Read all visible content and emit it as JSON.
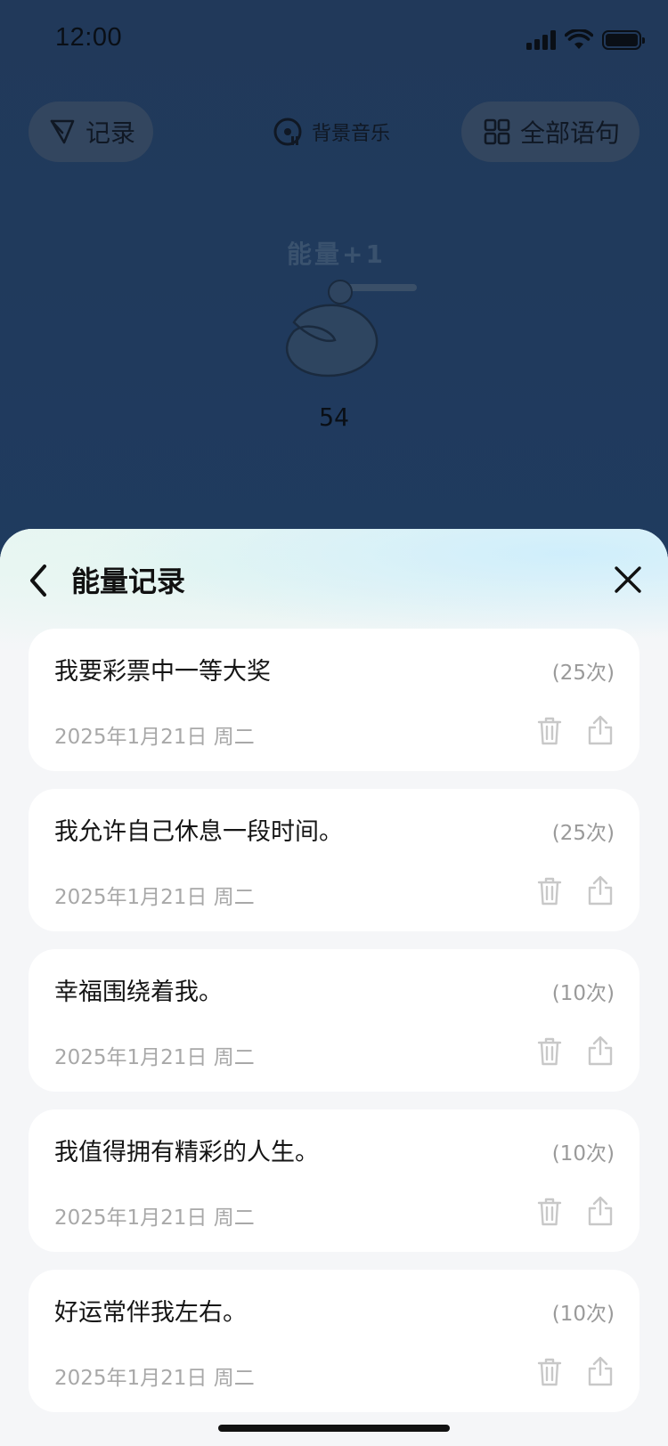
{
  "status_bar": {
    "time": "12:00"
  },
  "top_bar": {
    "record_label": "记录",
    "bgm_label": "背景音乐",
    "all_label": "全部语句"
  },
  "energy": {
    "plus_label": "能量+1",
    "count": "54"
  },
  "sheet": {
    "title": "能量记录",
    "records": [
      {
        "text": "我要彩票中一等大奖",
        "count": "(25次)",
        "date": "2025年1月21日 周二"
      },
      {
        "text": "我允许自己休息一段时间。",
        "count": "(25次)",
        "date": "2025年1月21日 周二"
      },
      {
        "text": "幸福围绕着我。",
        "count": "(10次)",
        "date": "2025年1月21日 周二"
      },
      {
        "text": "我值得拥有精彩的人生。",
        "count": "(10次)",
        "date": "2025年1月21日 周二"
      },
      {
        "text": "好运常伴我左右。",
        "count": "(10次)",
        "date": "2025年1月21日 周二"
      }
    ]
  },
  "icons": {
    "record": "leaf-icon",
    "bgm": "music-disc-icon",
    "all": "grid-icon",
    "back": "chevron-left-icon",
    "close": "close-icon",
    "delete": "trash-icon",
    "share": "share-icon"
  },
  "colors": {
    "overlay_bg": "#1f3b5f",
    "sheet_bg": "#f5f6f8",
    "card_bg": "#ffffff",
    "muted_text": "#a8a8a8"
  }
}
